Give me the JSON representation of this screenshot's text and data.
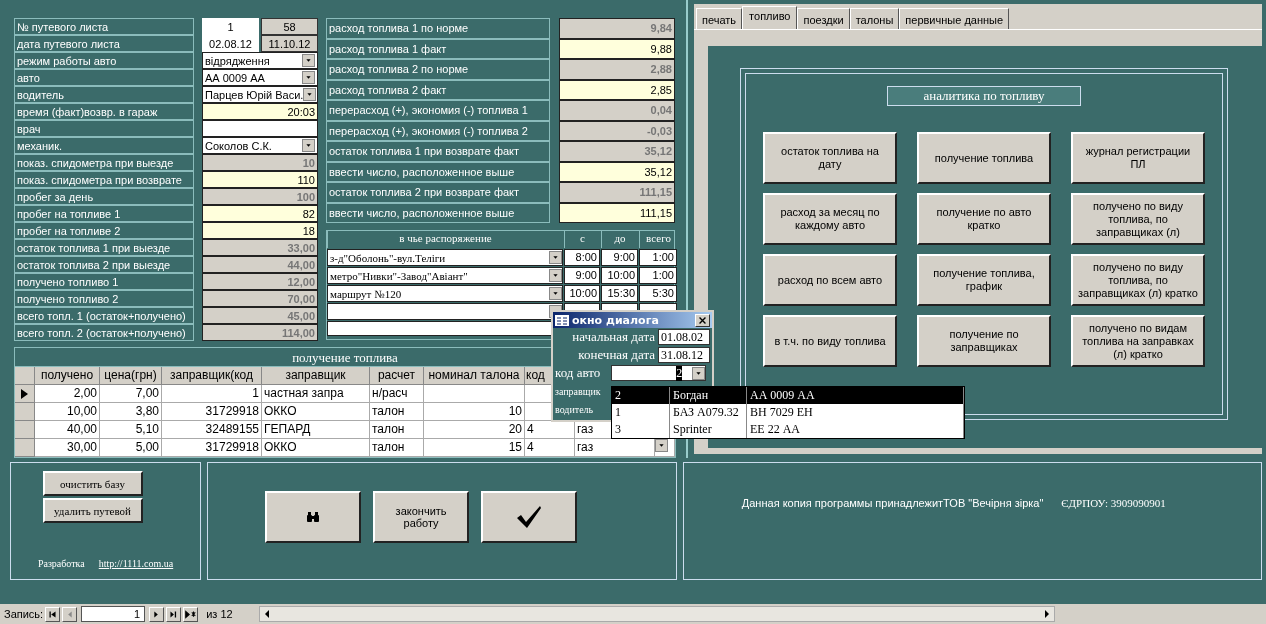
{
  "form": {
    "left_rows": [
      {
        "label": "№ путевого листа",
        "kind": "pair",
        "value": "1",
        "value2": "58"
      },
      {
        "label": "дата путевого листа",
        "kind": "pair",
        "value": "02.08.12",
        "value2": "11.10.12"
      },
      {
        "label": "режим работы авто",
        "kind": "combo",
        "value": "відрядження"
      },
      {
        "label": "авто",
        "kind": "combo",
        "value": "АА 0009 АА"
      },
      {
        "label": "водитель",
        "kind": "combo",
        "value": "Парцев Юрій Васи."
      },
      {
        "label": "время (факт)возвр. в гараж",
        "kind": "input",
        "value": "20:03"
      },
      {
        "label": "врач",
        "kind": "blank"
      },
      {
        "label": "механик.",
        "kind": "combo",
        "value": "Соколов С.К."
      },
      {
        "label": "показ. спидометра при выезде",
        "kind": "calc",
        "value": "10"
      },
      {
        "label": "показ. спидометра при возврате",
        "kind": "input",
        "value": "110"
      },
      {
        "label": "пробег за день",
        "kind": "calc",
        "value": "100"
      },
      {
        "label": "пробег на топливе 1",
        "kind": "input",
        "value": "82"
      },
      {
        "label": "пробег на топливе 2",
        "kind": "input",
        "value": "18"
      },
      {
        "label": "остаток  топлива 1 при выезде",
        "kind": "calc",
        "value": "33,00"
      },
      {
        "label": "остаток топлива 2 при выезде",
        "kind": "calc",
        "value": "44,00"
      },
      {
        "label": "получено топливо 1",
        "kind": "calc",
        "value": "12,00"
      },
      {
        "label": "получено топливо 2",
        "kind": "calc",
        "value": "70,00"
      },
      {
        "label": "всего топл. 1 (остаток+получено)",
        "kind": "calc",
        "value": "45,00"
      },
      {
        "label": "всего топл. 2 (остаток+получено)",
        "kind": "calc",
        "value": "114,00"
      }
    ],
    "right_rows": [
      {
        "label": "расход топлива 1 по норме",
        "kind": "calc",
        "value": "9,84"
      },
      {
        "label": "расход топлива 1 факт",
        "kind": "input",
        "value": "9,88"
      },
      {
        "label": "расход топлива 2 по норме",
        "kind": "calc",
        "value": "2,88"
      },
      {
        "label": "расход топлива 2 факт",
        "kind": "input",
        "value": "2,85"
      },
      {
        "label": "перерасход (+), экономия (-) топлива 1",
        "kind": "calc",
        "value": "0,04"
      },
      {
        "label": "перерасход (+), экономия (-) топлива 2",
        "kind": "calc",
        "value": "-0,03"
      },
      {
        "label": "остаток топлива 1 при возврате факт",
        "kind": "calc",
        "value": "35,12"
      },
      {
        "label": "ввести число, расположенное выше",
        "kind": "input",
        "value": "35,12"
      },
      {
        "label": "остаток топлива 2 при возврате факт",
        "kind": "calc",
        "value": "111,15"
      },
      {
        "label": "ввести число, расположенное выше",
        "kind": "input",
        "value": "111,15"
      }
    ]
  },
  "routes": {
    "columns": [
      "в чье распоряжение",
      "с",
      "до",
      "всего"
    ],
    "rows": [
      {
        "route": "з-д\"Оболонь\"-вул.Теліги",
        "from": "8:00",
        "to": "9:00",
        "total": "1:00"
      },
      {
        "route": "метро\"Нивки\"-Завод\"Авіант\"",
        "from": "9:00",
        "to": "10:00",
        "total": "1:00"
      },
      {
        "route": "маршрут №120",
        "from": "10:00",
        "to": "15:30",
        "total": "5:30"
      }
    ]
  },
  "fuel_table": {
    "title": "получение топлива",
    "columns": [
      "получено",
      "цена(грн)",
      "заправщик(код",
      "заправщик",
      "расчет",
      "номинал талона",
      "код"
    ],
    "rows": [
      {
        "selected": true,
        "cells": [
          "2,00",
          "7,00",
          "1",
          "частная запра",
          "н/расч",
          null,
          null,
          null
        ]
      },
      {
        "selected": false,
        "cells": [
          "10,00",
          "3,80",
          "31729918",
          "ОККО",
          "талон",
          "10",
          null,
          null
        ]
      },
      {
        "selected": false,
        "cells": [
          "40,00",
          "5,10",
          "32489155",
          "ГЕПАРД",
          "талон",
          "20",
          "4",
          "газ"
        ]
      },
      {
        "selected": false,
        "cells": [
          "30,00",
          "5,00",
          "31729918",
          "ОККО",
          "талон",
          "15",
          "4",
          "газ"
        ]
      }
    ]
  },
  "dialog": {
    "title": "окно диалога",
    "fields": [
      {
        "label": "начальная дата",
        "kind": "text",
        "value": "01.08.02"
      },
      {
        "label": "конечная дата",
        "kind": "text",
        "value": "31.08.12"
      },
      {
        "label": "код авто",
        "kind": "combo",
        "value": "2"
      },
      {
        "label": "заправщик",
        "kind": "hidden"
      },
      {
        "label": "водитель",
        "kind": "hidden"
      }
    ],
    "list": [
      {
        "selected": true,
        "cells": [
          "2",
          "Богдан",
          "АА 0009 АА"
        ]
      },
      {
        "selected": false,
        "cells": [
          "1",
          "БАЗ А079.32",
          "ВН 7029 ЕН"
        ]
      },
      {
        "selected": false,
        "cells": [
          "3",
          "Sprinter",
          "ЕЕ 22 АА"
        ]
      }
    ]
  },
  "tabs": [
    {
      "label": "печать",
      "selected": false
    },
    {
      "label": "топливо",
      "selected": true
    },
    {
      "label": "поездки",
      "selected": false
    },
    {
      "label": "талоны",
      "selected": false
    },
    {
      "label": "первичные данные",
      "selected": false
    }
  ],
  "analytics": {
    "title": "аналитика по топливу",
    "buttons": [
      "остаток топлива на дату",
      "получение топлива",
      "журнал регистрации ПЛ",
      "расход за месяц по каждому авто",
      "получение по авто кратко",
      "получено по виду топлива,  по заправщиках (л)",
      "расход по всем авто",
      "получение топлива, график",
      "получено по виду топлива,  по заправщиках (л) кратко",
      "в т.ч. по виду топлива",
      "получение по заправщиках",
      "получено по видам топлива на заправках (л) кратко"
    ]
  },
  "bottom": {
    "buttons": [
      "очистить базу",
      "удалить путевой"
    ],
    "credit": "Разработка",
    "link": "http://1111.com.ua",
    "actions": [
      {
        "kind": "search"
      },
      {
        "kind": "text",
        "label": "закончить работу"
      },
      {
        "kind": "check"
      }
    ],
    "owner": "Данная копия программы принадлежитТОВ \"Вечірня зірка\"",
    "code": "ЄДРПОУ: 3909090901"
  },
  "record_nav": {
    "label": "Запись:",
    "current": "1",
    "total": "из 12"
  }
}
